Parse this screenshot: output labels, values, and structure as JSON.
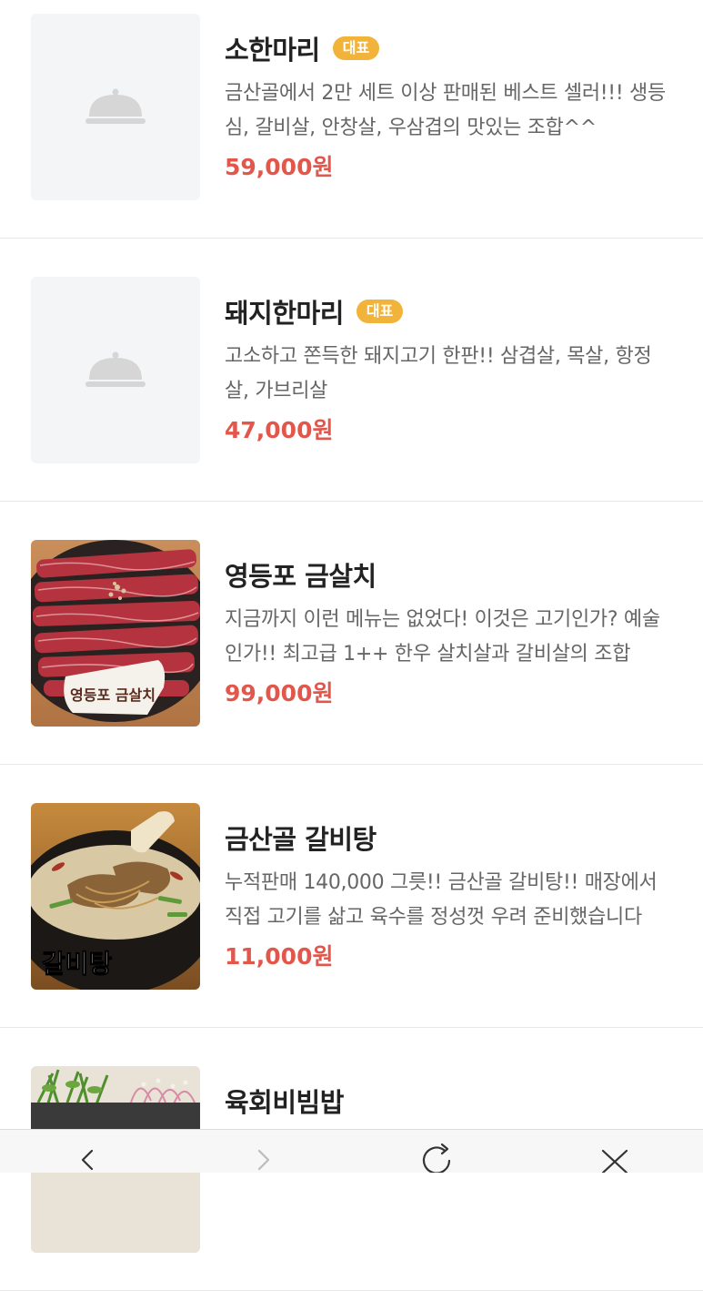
{
  "menu_items": [
    {
      "name": "소한마리",
      "badge": "대표",
      "description": "금산골에서 2만 세트 이상 판매된 베스트 셀러!!! 생등심, 갈비살, 안창살, 우삼겹의 맛있는 조합^^",
      "price": "59,000원",
      "image": "placeholder-dish-icon"
    },
    {
      "name": "돼지한마리",
      "badge": "대표",
      "description": "고소하고 쫀득한 돼지고기 한판!! 삼겹살, 목살, 항정살, 가브리살",
      "price": "47,000원",
      "image": "placeholder-dish-icon"
    },
    {
      "name": "영등포 금살치",
      "badge": "",
      "description": "지금까지 이런 메뉴는 없었다! 이것은 고기인가? 예술인가!! 최고급 1++ 한우 살치살과 갈비살의 조합",
      "price": "99,000원",
      "image": "beef-platter-photo",
      "image_caption": "영등포 금살치"
    },
    {
      "name": "금산골 갈비탕",
      "badge": "",
      "description": "누적판매 140,000 그릇!! 금산골 갈비탕!! 매장에서 직접 고기를 삶고 육수를 정성껏 우려 준비했습니다",
      "price": "11,000원",
      "image": "galbitang-photo",
      "image_caption": "갈비탕"
    },
    {
      "name": "육회비빔밥",
      "badge": "",
      "description": "",
      "price": "",
      "image": "bibimbap-photo"
    }
  ],
  "bottom_nav": {
    "back": "back-icon",
    "forward": "forward-icon",
    "reload": "reload-icon",
    "close": "close-icon"
  },
  "colors": {
    "badge": "#f2b33a",
    "price": "#e2574c",
    "placeholder_bg": "#f4f5f7"
  }
}
